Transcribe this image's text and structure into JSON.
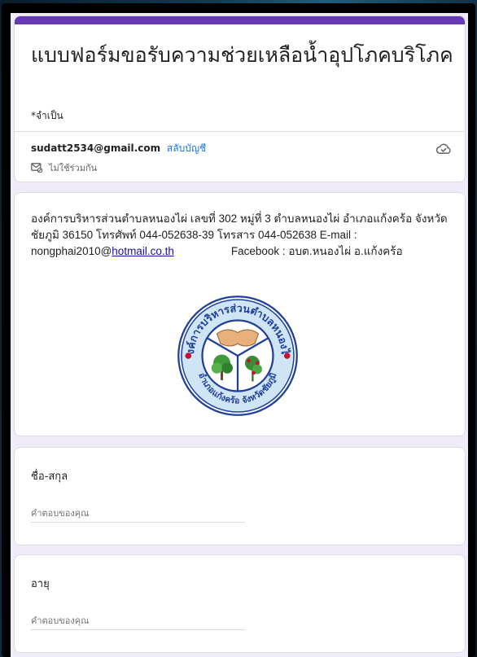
{
  "form": {
    "title": "แบบฟอร์มขอรับความช่วยเหลือน้ำอุปโภคบริโภค",
    "required_note": "*จำเป็น",
    "account_email": "sudatt2534@gmail.com",
    "switch_account": "สลับบัญชี",
    "not_shared": "ไม่ใช้ร่วมกัน",
    "accent_color": "#673ab7",
    "background_color": "#f0ebf8"
  },
  "info": {
    "line1": "องค์การบริหารส่วนตำบลหนองไผ่  เลขที่ 302 หมู่ที่ 3 ตำบลหนองไผ่ อำเภอแก้งคร้อ จังหวัดชัยภูมิ  36150  โทรศัพท์ 044-052638-39  โทรสาร 044-052638  E-mail : nongphai2010@",
    "email_link": "hotmail.co.th",
    "facebook": "Facebook : อบต.หนองไผ่ อ.แก้งคร้อ",
    "logo_top_text": "องค์การบริหารส่วนตำบลหนองไผ่",
    "logo_bottom_text": "อำเภอแก้งคร้อ จังหวัดชัยภูมิ"
  },
  "questions": [
    {
      "label": "ชื่อ-สกุล",
      "placeholder": "คำตอบของคุณ",
      "value": ""
    },
    {
      "label": "อายุ",
      "placeholder": "คำตอบของคุณ",
      "value": ""
    }
  ]
}
